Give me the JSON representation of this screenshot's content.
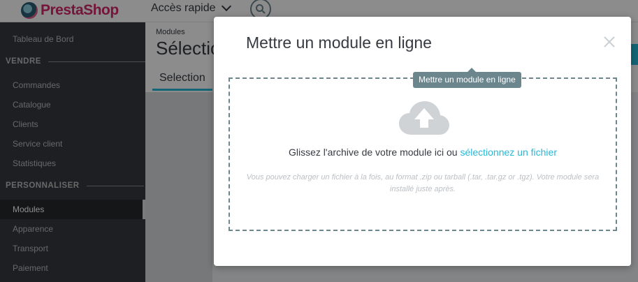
{
  "topbar": {
    "logo_text": "PrestaShop",
    "quick_access_label": "Accès rapide",
    "chevron_icon": "chevron-down-icon",
    "search_icon": "search-icon"
  },
  "sidebar": {
    "dashboard": "Tableau de Bord",
    "section_sell": "VENDRE",
    "orders": "Commandes",
    "catalog": "Catalogue",
    "customers": "Clients",
    "customer_service": "Service client",
    "stats": "Statistiques",
    "section_customize": "PERSONNALISER",
    "modules": "Modules",
    "appearance": "Apparence",
    "shipping": "Transport",
    "payment": "Paiement"
  },
  "main": {
    "breadcrumb": "Modules",
    "page_title": "Sélectio",
    "tab_selection": "Selection"
  },
  "modal": {
    "title": "Mettre un module en ligne",
    "tooltip": "Mettre un module en ligne",
    "drop_text_prefix": "Glissez l'archive de votre module ici ou ",
    "drop_link": "sélectionnez un fichier",
    "drop_help": "Vous pouvez charger un fichier à la fois, au format .zip ou tarball (.tar, .tar.gz or .tgz). Votre module sera installé juste après.",
    "upload_icon": "cloud-upload-icon",
    "close_icon": "close-icon"
  },
  "colors": {
    "brand": "#d6276b",
    "accent": "#25b9d7",
    "sidebar_bg": "#363a41",
    "tooltip_bg": "#6c868e"
  }
}
